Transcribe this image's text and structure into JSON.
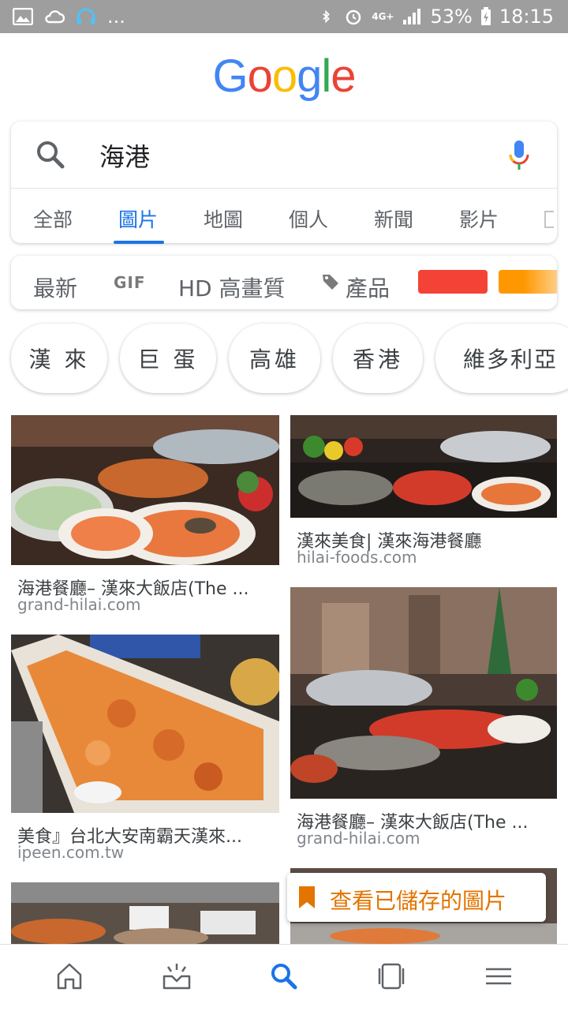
{
  "status_bar": {
    "left_icons": [
      "image-icon",
      "cloud-icon",
      "headphones-icon"
    ],
    "more": "...",
    "right_icons": [
      "bluetooth-icon",
      "alarm-icon",
      "signal-icon"
    ],
    "network": "4G+",
    "battery": "53%",
    "time": "18:15"
  },
  "logo": {
    "letters": [
      {
        "ch": "G",
        "color": "#4285F4"
      },
      {
        "ch": "o",
        "color": "#EA4335"
      },
      {
        "ch": "o",
        "color": "#FBBC05"
      },
      {
        "ch": "g",
        "color": "#4285F4"
      },
      {
        "ch": "l",
        "color": "#34A853"
      },
      {
        "ch": "e",
        "color": "#EA4335"
      }
    ]
  },
  "search": {
    "query": "海港"
  },
  "tabs": {
    "items": [
      "全部",
      "圖片",
      "地圖",
      "個人",
      "新聞",
      "影片"
    ],
    "active": "圖片"
  },
  "filters": {
    "newest": "最新",
    "gif": "GIF",
    "hd": "HD 高畫質",
    "products": "產品",
    "color_chips": [
      "#f44336",
      "#ff9800"
    ]
  },
  "related_chips": [
    "漢 來",
    "巨 蛋",
    "高雄",
    "香港",
    "維多利亞"
  ],
  "results": [
    {
      "caption": "海港餐廳– 漢來大飯店(The ...",
      "domain": "grand-hilai.com"
    },
    {
      "caption": "漢來美食| 漢來海港餐廳",
      "domain": "hilai-foods.com"
    },
    {
      "caption": "美食』台北大安南霸天漢來...",
      "domain": "ipeen.com.tw"
    },
    {
      "caption": "海港餐廳– 漢來大飯店(The ...",
      "domain": "grand-hilai.com"
    }
  ],
  "saved_button": {
    "label": "查看已儲存的圖片"
  },
  "bottom_nav": [
    "home-icon",
    "updates-icon",
    "search-icon",
    "tabs-icon",
    "menu-icon"
  ],
  "bottom_nav_active": "search-icon",
  "colors": {
    "accent": "#1a73e8",
    "saved_orange": "#e37400"
  }
}
